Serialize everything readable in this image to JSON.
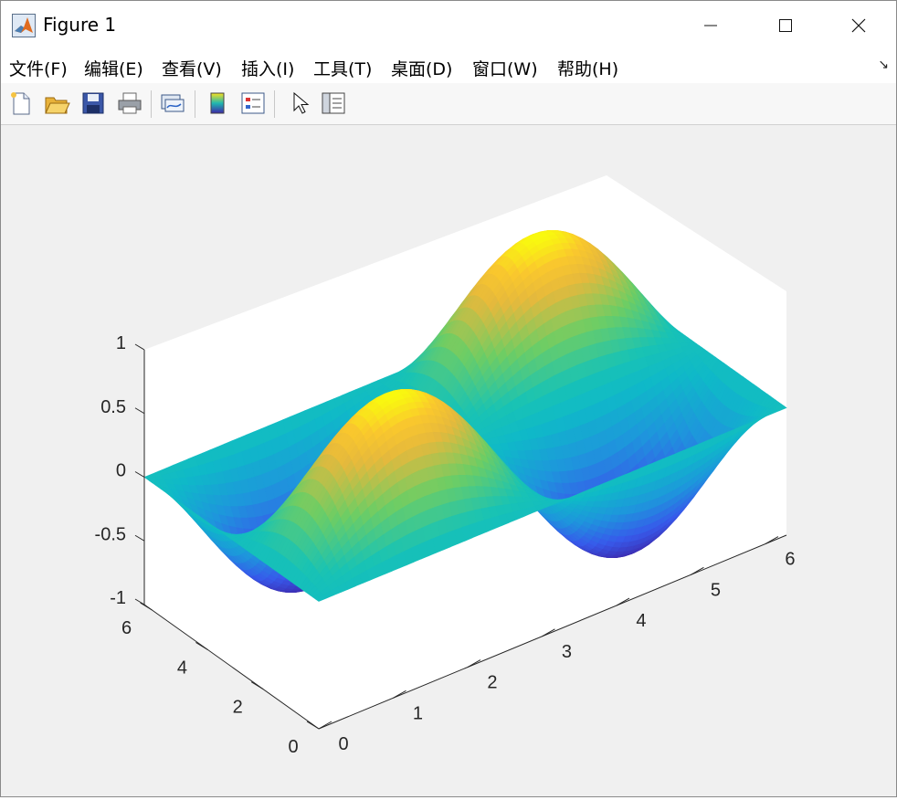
{
  "window": {
    "title": "Figure 1",
    "icon": "matlab-logo-icon"
  },
  "menu": {
    "items": [
      {
        "label": "文件(F)"
      },
      {
        "label": "编辑(E)"
      },
      {
        "label": "查看(V)"
      },
      {
        "label": "插入(I)"
      },
      {
        "label": "工具(T)"
      },
      {
        "label": "桌面(D)"
      },
      {
        "label": "窗口(W)"
      },
      {
        "label": "帮助(H)"
      }
    ]
  },
  "toolbar": {
    "tools": [
      "new-figure-icon",
      "open-file-icon",
      "save-icon",
      "print-icon",
      "link-plot-icon",
      "colorbar-icon",
      "legend-icon",
      "pointer-icon",
      "property-inspector-icon"
    ]
  },
  "chart_data": {
    "type": "surface",
    "function": "z = sin(x) * sin(y)",
    "colormap": "parula",
    "x_range": [
      0,
      6.2832
    ],
    "y_range": [
      0,
      6.2832
    ],
    "zlim": [
      -1,
      1
    ],
    "xticks": [
      "0",
      "1",
      "2",
      "3",
      "4",
      "5",
      "6"
    ],
    "yticks": [
      "0",
      "2",
      "4",
      "6"
    ],
    "zticks": [
      "-1",
      "-0.5",
      "0",
      "0.5",
      "1"
    ],
    "grid": false
  }
}
